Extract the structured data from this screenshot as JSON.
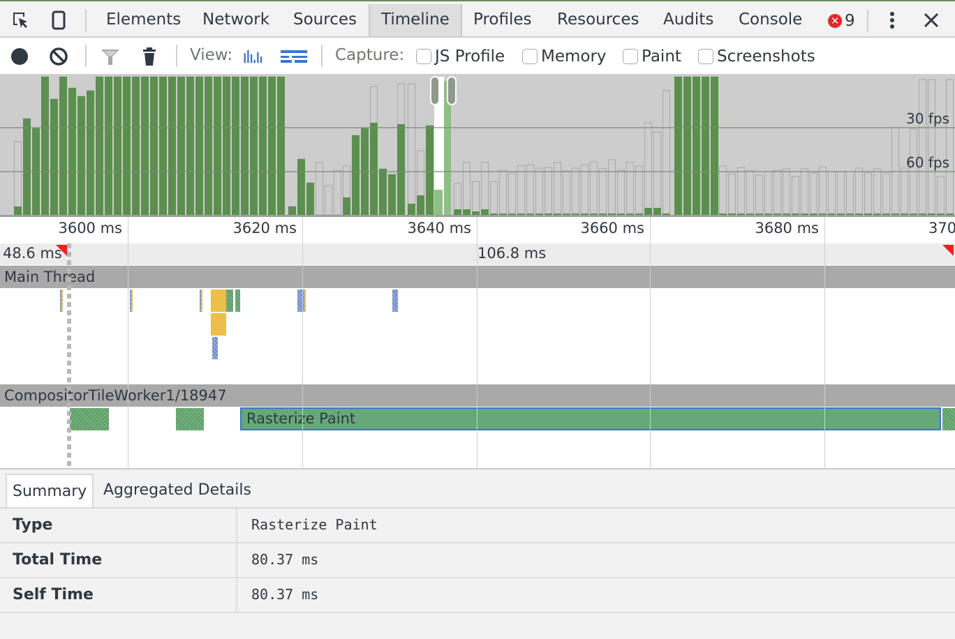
{
  "tabbar": {
    "tabs": [
      {
        "label": "Elements",
        "active": false
      },
      {
        "label": "Network",
        "active": false
      },
      {
        "label": "Sources",
        "active": false
      },
      {
        "label": "Timeline",
        "active": true
      },
      {
        "label": "Profiles",
        "active": false
      },
      {
        "label": "Resources",
        "active": false
      },
      {
        "label": "Audits",
        "active": false
      },
      {
        "label": "Console",
        "active": false
      }
    ],
    "error_count": "9",
    "icons": [
      "inspect-element-icon",
      "device-mode-icon",
      "error-icon",
      "more-menu-icon",
      "close-icon"
    ]
  },
  "toolbar": {
    "view_label": "View:",
    "capture_label": "Capture:",
    "checkboxes": [
      {
        "label": "JS Profile",
        "checked": false
      },
      {
        "label": "Memory",
        "checked": false
      },
      {
        "label": "Paint",
        "checked": false
      },
      {
        "label": "Screenshots",
        "checked": false
      }
    ],
    "icons": [
      "record-icon",
      "clear-icon",
      "filter-icon",
      "garbage-collect-icon",
      "bar-view-icon",
      "flame-view-icon"
    ]
  },
  "overview": {
    "fps_labels": [
      "30 fps",
      "60 fps"
    ],
    "colors": {
      "painting": "#5a8f4e",
      "painting_light": "#8fbf86",
      "scripting": "#edbe48",
      "rendering": "#6a8bd4",
      "idle": "#cdcdcd"
    }
  },
  "ruler": {
    "ticks": [
      "3600 ms",
      "3620 ms",
      "3640 ms",
      "3660 ms",
      "3680 ms",
      "370"
    ]
  },
  "frames": {
    "labels": [
      "48.6 ms",
      "106.8 ms"
    ]
  },
  "threads": {
    "main": "Main Thread",
    "compositor": "CompositorTileWorker1/18947",
    "selected_event": "Rasterize Paint"
  },
  "details": {
    "tabs": [
      {
        "label": "Summary",
        "active": true
      },
      {
        "label": "Aggregated Details",
        "active": false
      }
    ],
    "rows": [
      {
        "key": "Type",
        "value": "Rasterize Paint"
      },
      {
        "key": "Total Time",
        "value": "80.37 ms"
      },
      {
        "key": "Self Time",
        "value": "80.37 ms"
      }
    ]
  }
}
